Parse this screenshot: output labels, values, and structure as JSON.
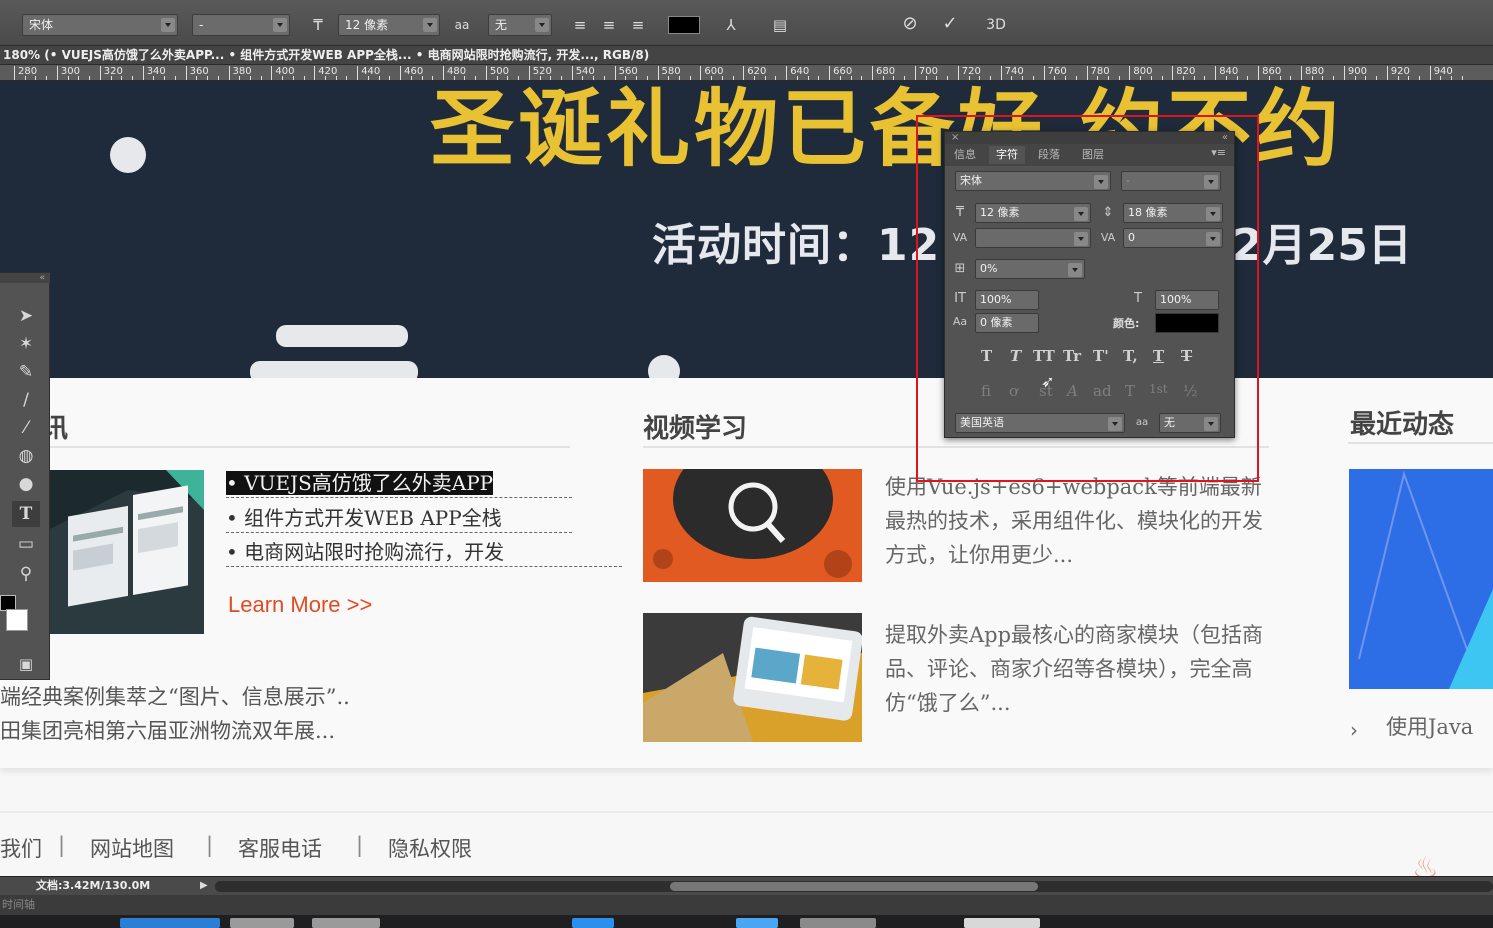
{
  "options_bar": {
    "font_family": "宋体",
    "font_style": "-",
    "font_size": "12 像素",
    "aa_icon": "aa",
    "antialias": "无",
    "commit_label": "3D",
    "cancel_icon": "cancel-icon",
    "commit_icon": "check-icon"
  },
  "document_tab": {
    "title": "180% (• VUEJS高仿饿了么外卖APP... • 组件方式开发WEB APP全栈... • 电商网站限时抢购流行, 开发..., RGB/8)"
  },
  "ruler": {
    "ticks": [
      "280",
      "300",
      "320",
      "340",
      "360",
      "380",
      "400",
      "420",
      "440",
      "460",
      "480",
      "500",
      "520",
      "540",
      "560",
      "580",
      "600",
      "620",
      "640",
      "660",
      "680",
      "700",
      "720",
      "740",
      "760",
      "780",
      "800",
      "820",
      "840",
      "860",
      "880",
      "900",
      "920",
      "940"
    ]
  },
  "banner": {
    "title": "圣诞礼物已备好 约不约",
    "subtitle_left": "活动时间：12",
    "subtitle_right": "2月25日",
    "colors": {
      "bg": "#1f2b3b",
      "title": "#e8c233"
    }
  },
  "news_section": {
    "heading": "讯",
    "items": [
      "• VUEJS高仿饿了么外卖APP",
      "• 组件方式开发WEB APP全栈",
      "• 电商网站限时抢购流行，开发"
    ],
    "learn_more": "Learn More >>",
    "extra_lines": [
      "端经典案例集萃之“图片、信息展示”..",
      "田集团亮相第六届亚洲物流双年展..."
    ]
  },
  "video_section": {
    "heading": "视频学习",
    "items": [
      {
        "text": "使用Vue.js+es6+webpack等前端最新最热的技术，采用组件化、模块化的开发方式，让你用更少..."
      },
      {
        "text": "提取外卖App最核心的商家模块（包括商品、评论、商家介绍等各模块），完全高仿“饿了么”..."
      }
    ]
  },
  "recent_section": {
    "heading": "最近动态",
    "item": "使用Java"
  },
  "footer_links": [
    "我们",
    "|",
    "网站地图",
    "|",
    "客服电话",
    "|",
    "隐私权限"
  ],
  "character_panel": {
    "tabs": [
      "信息",
      "字符",
      "段落",
      "图层"
    ],
    "active_tab": "字符",
    "font_family": "宋体",
    "font_style": "-",
    "font_size": "12 像素",
    "leading": "18 像素",
    "kerning": "",
    "tracking": "0",
    "tsume": "0%",
    "vertical_scale": "100%",
    "horizontal_scale": "100%",
    "baseline_shift": "0 像素",
    "color_label": "颜色:",
    "color": "#000000",
    "type_styles": [
      "T",
      "T",
      "TT",
      "Tr",
      "T'",
      "T,",
      "T",
      "T"
    ],
    "opentype": [
      "fi",
      "ơ",
      "st",
      "A",
      "ad",
      "T",
      "1st",
      "½"
    ],
    "language": "美国英语",
    "aa_icon": "aa",
    "antialias": "无"
  },
  "status_bar": {
    "doc_size": "文档:3.42M/130.0M"
  },
  "timeline": {
    "label": "时间轴"
  }
}
